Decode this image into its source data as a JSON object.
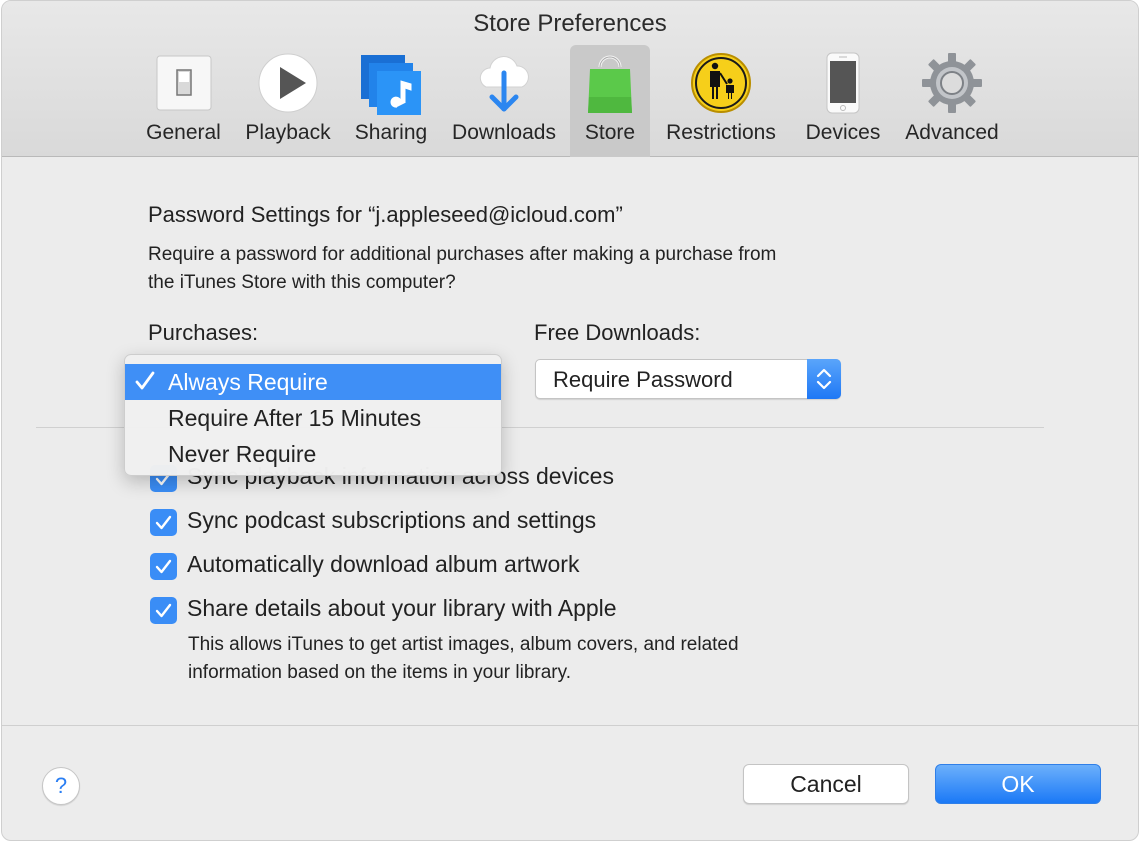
{
  "window": {
    "title": "Store Preferences"
  },
  "toolbar": {
    "items": [
      {
        "label": "General",
        "icon": "toggle-switch-icon",
        "selected": false
      },
      {
        "label": "Playback",
        "icon": "play-icon",
        "selected": false
      },
      {
        "label": "Sharing",
        "icon": "music-sharing-icon",
        "selected": false
      },
      {
        "label": "Downloads",
        "icon": "cloud-download-icon",
        "selected": false
      },
      {
        "label": "Store",
        "icon": "shopping-bag-icon",
        "selected": true
      },
      {
        "label": "Restrictions",
        "icon": "parental-controls-icon",
        "selected": false
      },
      {
        "label": "Devices",
        "icon": "iphone-icon",
        "selected": false
      },
      {
        "label": "Advanced",
        "icon": "gear-icon",
        "selected": false
      }
    ]
  },
  "password_settings": {
    "heading": "Password Settings for “j.appleseed@icloud.com”",
    "description_line1": "Require a password for additional purchases after making a purchase from",
    "description_line2": "the iTunes Store with this computer?",
    "purchases": {
      "label": "Purchases:",
      "selected": "Always Require",
      "options": [
        "Always Require",
        "Require After 15 Minutes",
        "Never Require"
      ]
    },
    "free_downloads": {
      "label": "Free Downloads:",
      "selected": "Require Password"
    }
  },
  "options": [
    {
      "label": "Sync playback information across devices",
      "checked": true
    },
    {
      "label": "Sync podcast subscriptions and settings",
      "checked": true
    },
    {
      "label": "Automatically download album artwork",
      "checked": true
    },
    {
      "label": "Share details about your library with Apple",
      "checked": true
    }
  ],
  "share_note_line1": "This allows iTunes to get artist images, album covers, and related",
  "share_note_line2": "information based on the items in your library.",
  "footer": {
    "help_label": "?",
    "cancel_label": "Cancel",
    "ok_label": "OK"
  },
  "colors": {
    "accent": "#3f8ff6",
    "store_green": "#5bc94a",
    "restrictions_yellow": "#f6cf1a"
  }
}
